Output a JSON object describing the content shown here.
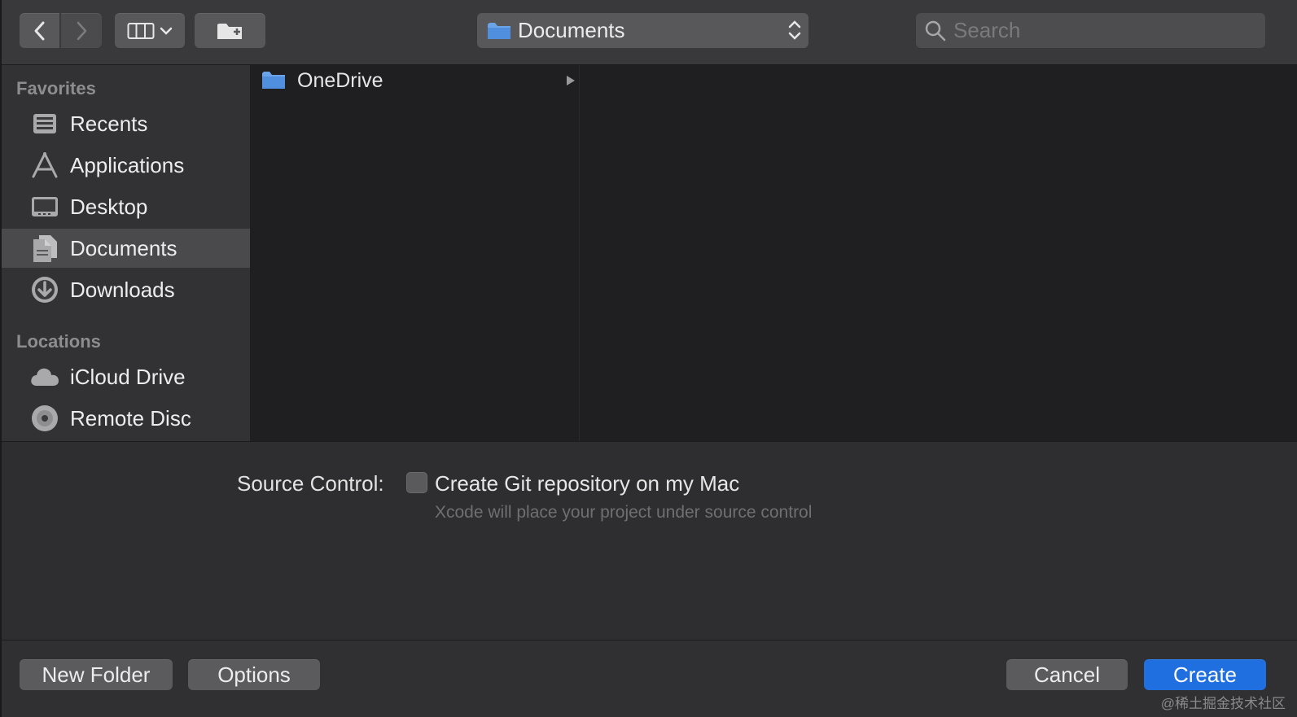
{
  "toolbar": {
    "location": "Documents",
    "search_placeholder": "Search"
  },
  "sidebar": {
    "favorites_header": "Favorites",
    "favorites": [
      {
        "label": "Recents",
        "icon": "recents-icon"
      },
      {
        "label": "Applications",
        "icon": "applications-icon"
      },
      {
        "label": "Desktop",
        "icon": "desktop-icon"
      },
      {
        "label": "Documents",
        "icon": "documents-icon",
        "selected": true
      },
      {
        "label": "Downloads",
        "icon": "downloads-icon"
      }
    ],
    "locations_header": "Locations",
    "locations": [
      {
        "label": "iCloud Drive",
        "icon": "cloud-icon"
      },
      {
        "label": "Remote Disc",
        "icon": "disc-icon"
      }
    ]
  },
  "browser": {
    "items": [
      {
        "label": "OneDrive",
        "icon": "folder-icon"
      }
    ]
  },
  "options": {
    "source_control_label": "Source Control:",
    "git_checkbox_label": "Create Git repository on my Mac",
    "git_checked": false,
    "git_hint": "Xcode will place your project under source control"
  },
  "buttons": {
    "new_folder": "New Folder",
    "options": "Options",
    "cancel": "Cancel",
    "create": "Create"
  },
  "watermark": "@稀土掘金技术社区",
  "colors": {
    "accent": "#1f6fe0",
    "folder": "#6aa3e8"
  }
}
